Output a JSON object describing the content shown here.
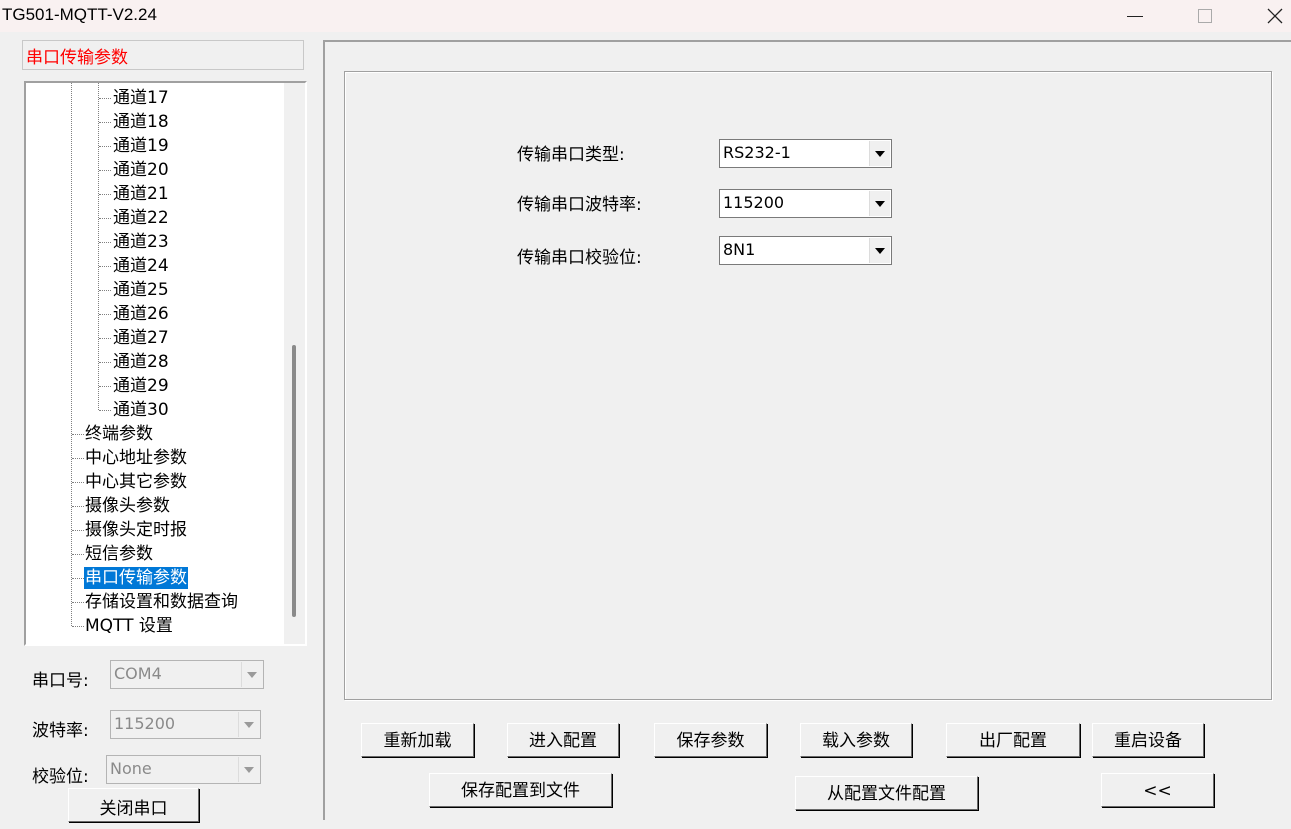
{
  "window": {
    "title": "TG501-MQTT-V2.24"
  },
  "left": {
    "selected_label": "串口传输参数",
    "tree": {
      "channels": [
        "通道17",
        "通道18",
        "通道19",
        "通道20",
        "通道21",
        "通道22",
        "通道23",
        "通道24",
        "通道25",
        "通道26",
        "通道27",
        "通道28",
        "通道29",
        "通道30"
      ],
      "items": [
        "终端参数",
        "中心地址参数",
        "中心其它参数",
        "摄像头参数",
        "摄像头定时报",
        "短信参数",
        "串口传输参数",
        "存储设置和数据查询",
        "MQTT 设置"
      ],
      "selected": "串口传输参数"
    },
    "port": {
      "label": "串口号:",
      "value": "COM4"
    },
    "baud": {
      "label": "波特率:",
      "value": "115200"
    },
    "parity": {
      "label": "校验位:",
      "value": "None"
    },
    "close_button": "关闭串口"
  },
  "form": {
    "type": {
      "label": "传输串口类型:",
      "value": "RS232-1"
    },
    "baud": {
      "label": "传输串口波特率:",
      "value": "115200"
    },
    "parity": {
      "label": "传输串口校验位:",
      "value": "8N1"
    }
  },
  "buttons": {
    "reload": "重新加载",
    "enter_config": "进入配置",
    "save_params": "保存参数",
    "load_params": "载入参数",
    "factory": "出厂配置",
    "restart": "重启设备",
    "save_to_file": "保存配置到文件",
    "from_file": "从配置文件配置",
    "collapse": "<<"
  }
}
